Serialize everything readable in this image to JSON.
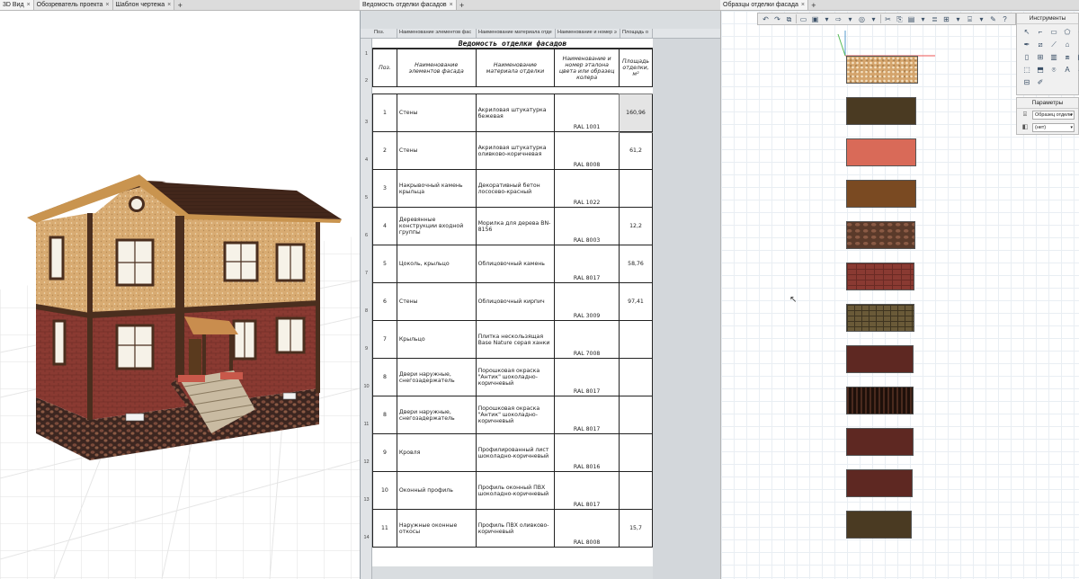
{
  "tabs": {
    "left": [
      {
        "label": "3D Вид"
      },
      {
        "label": "Обозреватель проекта"
      },
      {
        "label": "Шаблон чертежа"
      }
    ],
    "middle": {
      "label": "Ведомость отделки фасадов"
    },
    "right": {
      "label": "Образцы отделки фасада"
    }
  },
  "schedule": {
    "column_headers": [
      "Поз.",
      "Наименование элементов фас",
      "Наименование материала отде",
      "Наименование и номер э",
      "Площадь о"
    ],
    "title": "Ведомость отделки фасадов",
    "head": {
      "pos": "Поз.",
      "element": "Наименование элементов фасада",
      "material": "Наименование материала отделки",
      "color": "Наименование и номер эталона цвета или образец колера",
      "area": "Площадь отделки, м²"
    },
    "row_numbers": [
      "1",
      "2",
      "3",
      "4",
      "5",
      "6",
      "7",
      "8",
      "9",
      "10",
      "11",
      "12",
      "13",
      "14"
    ],
    "rows": [
      {
        "pos": "1",
        "element": "Стены",
        "material": "Акриловая штукатурка бежевая",
        "code": "RAL 1001",
        "area": "160,96"
      },
      {
        "pos": "2",
        "element": "Стены",
        "material": "Акриловая штукатурка оливково-коричневая",
        "code": "RAL 8008",
        "area": "61,2"
      },
      {
        "pos": "3",
        "element": "Накрывочный камень крыльца",
        "material": "Декоративный бетон лососево-красный",
        "code": "RAL 1022",
        "area": ""
      },
      {
        "pos": "4",
        "element": "Деревянные конструкции входной группы",
        "material": "Морилка для дерева BN-8156",
        "code": "RAL 8003",
        "area": "12,2"
      },
      {
        "pos": "5",
        "element": "Цоколь, крыльцо",
        "material": "Облицовочный камень",
        "code": "RAL 8017",
        "area": "58,76"
      },
      {
        "pos": "6",
        "element": "Стены",
        "material": "Облицовочный кирпич",
        "code": "RAL 3009",
        "area": "97,41"
      },
      {
        "pos": "7",
        "element": "Крыльцо",
        "material": "Плитка нескользящая Base Nature серая ханки",
        "code": "RAL 7008",
        "area": ""
      },
      {
        "pos": "8",
        "element": "Двери наружные, снегозадержатель",
        "material": "Порошковая окраска \"Антик\" шоколадно-коричневый",
        "code": "RAL 8017",
        "area": ""
      },
      {
        "pos": "8",
        "element": "Двери наружные, снегозадержатель",
        "material": "Порошковая окраска \"Антик\" шоколадно-коричневый",
        "code": "RAL 8017",
        "area": ""
      },
      {
        "pos": "9",
        "element": "Кровля",
        "material": "Профилированный лист шоколадно-коричневый",
        "code": "RAL 8016",
        "area": ""
      },
      {
        "pos": "10",
        "element": "Оконный профиль",
        "material": "Профиль оконный ПВХ шоколадно-коричневый",
        "code": "RAL 8017",
        "area": ""
      },
      {
        "pos": "11",
        "element": "Наружные оконные откосы",
        "material": "Профиль ПВХ оливково-коричневый",
        "code": "RAL 8008",
        "area": "15,7"
      }
    ]
  },
  "samples": {
    "swatches": [
      {
        "color": "#d4a46c",
        "pattern": "stucco"
      },
      {
        "color": "#4a3a22",
        "pattern": "solid"
      },
      {
        "color": "#d96a58",
        "pattern": "solid"
      },
      {
        "color": "#7a4a22",
        "pattern": "solid"
      },
      {
        "color": "#5a3a2a",
        "pattern": "stone"
      },
      {
        "color": "#8a3a32",
        "pattern": "brick"
      },
      {
        "color": "#6a5a38",
        "pattern": "tiles"
      },
      {
        "color": "#5e2822",
        "pattern": "solid"
      },
      {
        "color": "#2e1a14",
        "pattern": "stripes"
      },
      {
        "color": "#5e2822",
        "pattern": "solid"
      },
      {
        "color": "#5e2822",
        "pattern": "solid"
      },
      {
        "color": "#4a3a22",
        "pattern": "solid"
      }
    ],
    "tools_panel": {
      "title": "Инструменты"
    },
    "params_panel": {
      "title": "Параметры",
      "style_value": "Образец отделк",
      "layer_value": "(нет)"
    }
  },
  "colors": {
    "accent": "#3a4f66",
    "wall_beige": "#d4a46c",
    "brick": "#8a3a32",
    "trim": "#4a2e1e",
    "roof": "#3e2418"
  }
}
